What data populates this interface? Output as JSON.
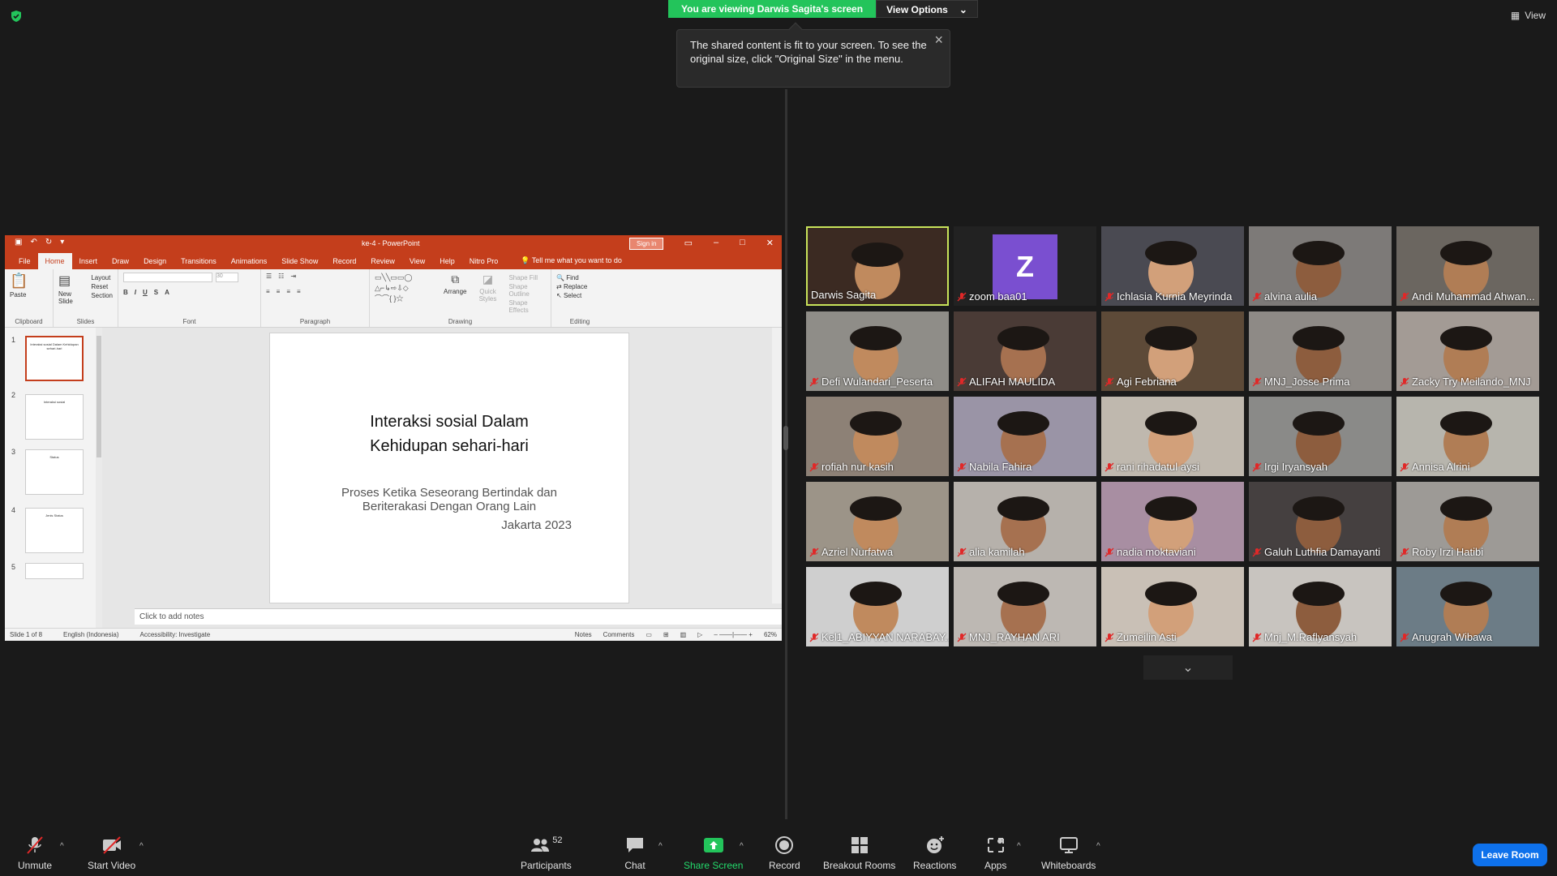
{
  "banner": {
    "viewing": "You are viewing Darwis Sagita's screen",
    "view_options": "View Options",
    "view": "View"
  },
  "tooltip": {
    "text": "The shared content is fit to your screen. To see the original size, click \"Original Size\" in the menu."
  },
  "ppt": {
    "filename": "ke-4  -  PowerPoint",
    "sign_in": "Sign in",
    "tabs": [
      "File",
      "Home",
      "Insert",
      "Draw",
      "Design",
      "Transitions",
      "Animations",
      "Slide Show",
      "Record",
      "Review",
      "View",
      "Help",
      "Nitro Pro"
    ],
    "tell_me": "Tell me what you want to do",
    "ribbon": {
      "paste": "Paste",
      "clipboard": "Clipboard",
      "new_slide": "New Slide",
      "layout": "Layout",
      "reset": "Reset",
      "section": "Section",
      "slides": "Slides",
      "font": "Font",
      "font_size": "30",
      "paragraph": "Paragraph",
      "arrange": "Arrange",
      "quick_styles": "Quick Styles",
      "shape_fill": "Shape Fill",
      "shape_outline": "Shape Outline",
      "shape_effects": "Shape Effects",
      "drawing": "Drawing",
      "find": "Find",
      "replace": "Replace",
      "select": "Select",
      "editing": "Editing"
    },
    "thumbs": [
      {
        "num": "1",
        "title": "Interaksi sosial Dalam Kehidupan sehari-hari"
      },
      {
        "num": "2",
        "title": "Interaksi sosial"
      },
      {
        "num": "3",
        "title": "Status"
      },
      {
        "num": "4",
        "title": "Jenis Status"
      },
      {
        "num": "5",
        "title": ""
      }
    ],
    "slide": {
      "title_line1": "Interaksi sosial Dalam",
      "title_line2": "Kehidupan sehari-hari",
      "sub_line1": "Proses Ketika Seseorang Bertindak dan",
      "sub_line2": "Beriterakasi Dengan Orang Lain",
      "date": "Jakarta 2023"
    },
    "notes_placeholder": "Click to add notes",
    "status": {
      "slide": "Slide 1 of 8",
      "language": "English (Indonesia)",
      "accessibility": "Accessibility: Investigate",
      "notes": "Notes",
      "comments": "Comments",
      "zoom": "62%"
    }
  },
  "participants": [
    {
      "name": "Darwis Sagita",
      "muted": false,
      "active": true
    },
    {
      "name": "zoom baa01",
      "muted": true,
      "avatar": "Z"
    },
    {
      "name": "Ichlasia Kurnia Meyrinda",
      "muted": true
    },
    {
      "name": "alvina aulia",
      "muted": true
    },
    {
      "name": "Andi Muhammad Ahwan...",
      "muted": true
    },
    {
      "name": "Defi Wulandari_Peserta",
      "muted": true
    },
    {
      "name": "ALIFAH MAULIDA",
      "muted": true
    },
    {
      "name": "Agi Febriana",
      "muted": true
    },
    {
      "name": "MNJ_Josse Prima",
      "muted": true
    },
    {
      "name": "Zacky Try Meilando_MNJ",
      "muted": true
    },
    {
      "name": "rofiah nur kasih",
      "muted": true
    },
    {
      "name": "Nabila Fahira",
      "muted": true
    },
    {
      "name": "rani rihadatul aysi",
      "muted": true
    },
    {
      "name": "Irgi Iryansyah",
      "muted": true
    },
    {
      "name": "Annisa Alrini",
      "muted": true
    },
    {
      "name": "Azriel Nurfatwa",
      "muted": true
    },
    {
      "name": "alia kamilah",
      "muted": true
    },
    {
      "name": "nadia moktaviani",
      "muted": true
    },
    {
      "name": "Galuh Luthfia Damayanti",
      "muted": true
    },
    {
      "name": "Roby Irzi Hatibi",
      "muted": true
    },
    {
      "name": "Kel1_ABIYYAN NARABAY...",
      "muted": true
    },
    {
      "name": "MNJ_RAYHAN ARI",
      "muted": true
    },
    {
      "name": "Zumeilin Asti",
      "muted": true
    },
    {
      "name": "Mnj_M.Raflyansyah",
      "muted": true
    },
    {
      "name": "Anugrah Wibawa",
      "muted": true
    }
  ],
  "toolbar": {
    "unmute": "Unmute",
    "start_video": "Start Video",
    "participants": "Participants",
    "participant_count": "52",
    "chat": "Chat",
    "share_screen": "Share Screen",
    "record": "Record",
    "breakout_rooms": "Breakout Rooms",
    "reactions": "Reactions",
    "apps": "Apps",
    "whiteboards": "Whiteboards",
    "leave": "Leave Room"
  }
}
